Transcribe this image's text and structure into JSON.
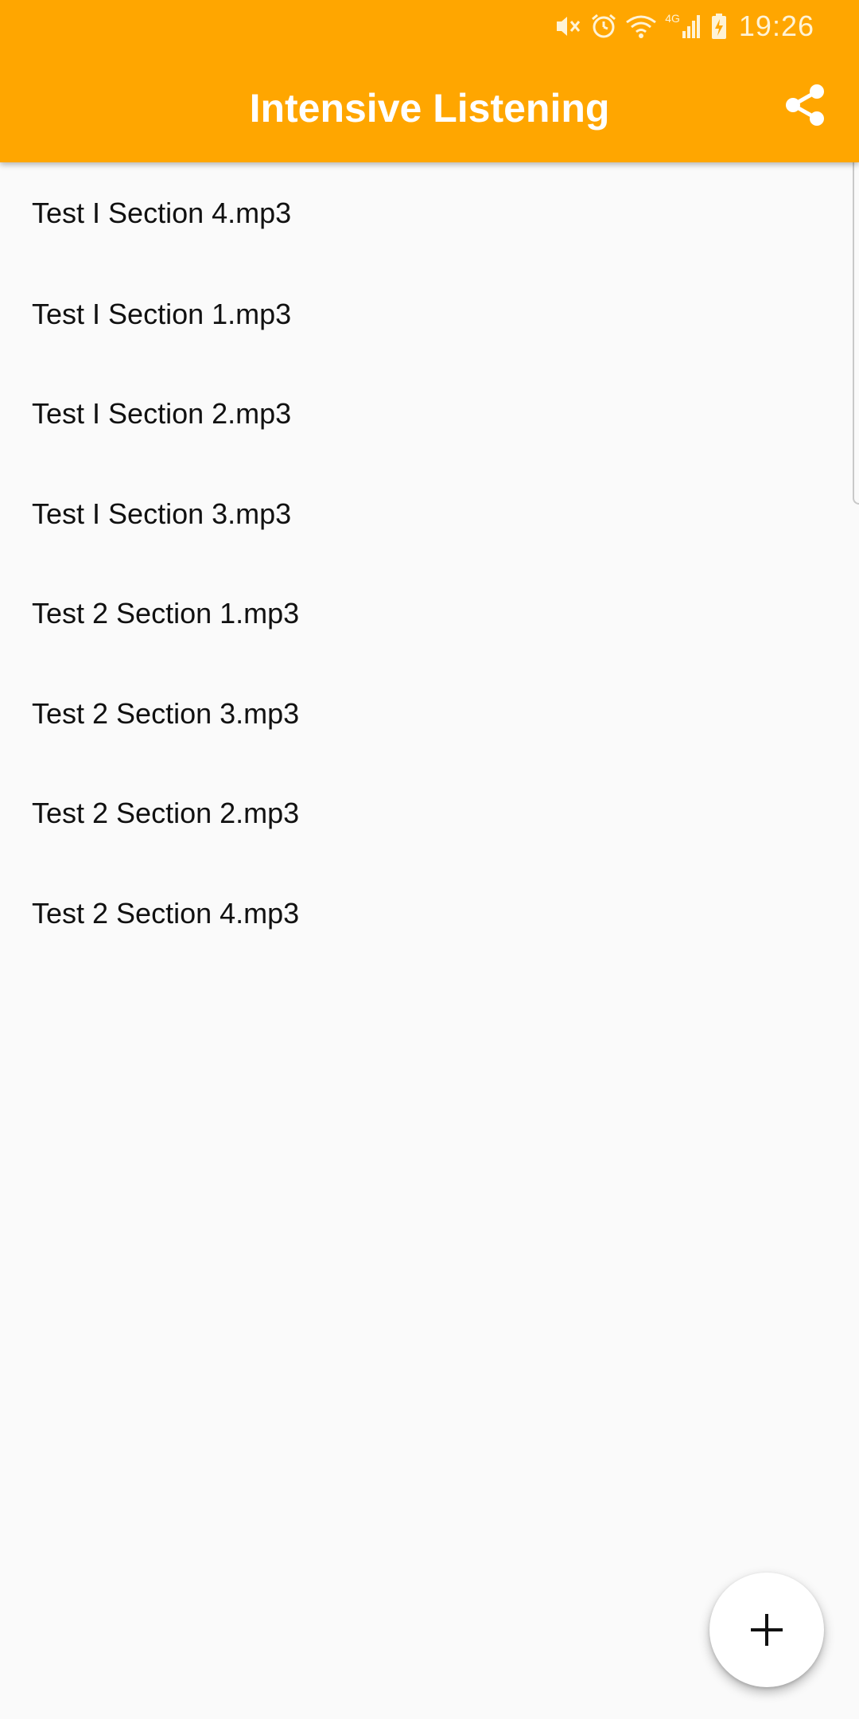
{
  "status_bar": {
    "time": "19:26",
    "network_label": "4G",
    "icons": [
      "mute-vibrate-icon",
      "alarm-icon",
      "wifi-icon",
      "cellular-signal-icon",
      "battery-charging-icon"
    ]
  },
  "app_bar": {
    "title": "Intensive Listening",
    "background_color": "#FFA600",
    "action_icon": "share-icon"
  },
  "files": [
    {
      "label": "Test I Section 4.mp3"
    },
    {
      "label": "Test I Section 1.mp3"
    },
    {
      "label": "Test I Section 2.mp3"
    },
    {
      "label": "Test I Section 3.mp3"
    },
    {
      "label": "Test 2 Section 1.mp3"
    },
    {
      "label": "Test 2 Section 3.mp3"
    },
    {
      "label": "Test 2 Section 2.mp3"
    },
    {
      "label": "Test 2 Section 4.mp3"
    }
  ],
  "fab": {
    "icon": "plus-icon"
  }
}
